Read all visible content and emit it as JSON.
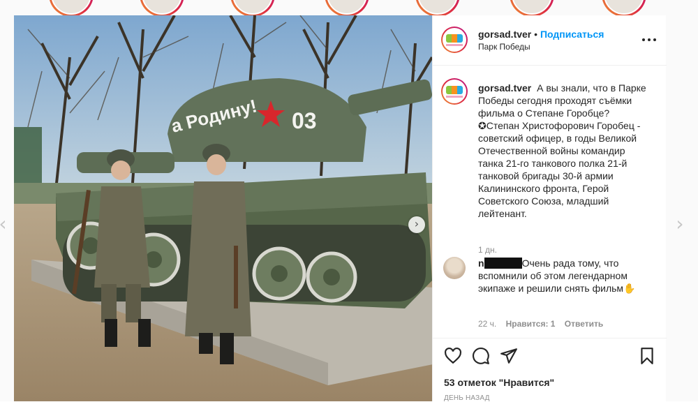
{
  "post": {
    "username": "gorsad.tver",
    "follow_label": "Подписаться",
    "separator": "•",
    "location": "Парк Победы",
    "caption": "А вы знали, что в Парке Победы сегодня проходят съёмки фильма о Степане Горобце? ✪Степан Христофорович Горобец - советский офицер, в годы Великой Отечественной войны командир танка 21-го танкового полка 21-й танковой бригады 30-й армии Калининского фронта, Герой Советского Союза, младший лейтенант.",
    "caption_time": "1 дн.",
    "tank_text": "а Родину!",
    "tank_number": "03"
  },
  "comment": {
    "username_visible": "n",
    "text": "Очень рада тому, что вспомнили об этом легендарном экипаже и решили снять фильм✋",
    "time": "22 ч.",
    "likes": "Нравится: 1",
    "reply": "Ответить"
  },
  "actions": {
    "likes_count": "53 отметок \"Нравится\"",
    "date": "ДЕНЬ НАЗАД"
  },
  "icons": {
    "more": "more-options-icon",
    "like": "heart-icon",
    "comment": "comment-icon",
    "share": "share-icon",
    "save": "bookmark-icon",
    "next": "chevron-right-icon",
    "prev": "chevron-left-icon"
  },
  "colors": {
    "accent": "#0095f6",
    "muted": "#8e8e8e",
    "text": "#262626",
    "border": "#efefef"
  }
}
